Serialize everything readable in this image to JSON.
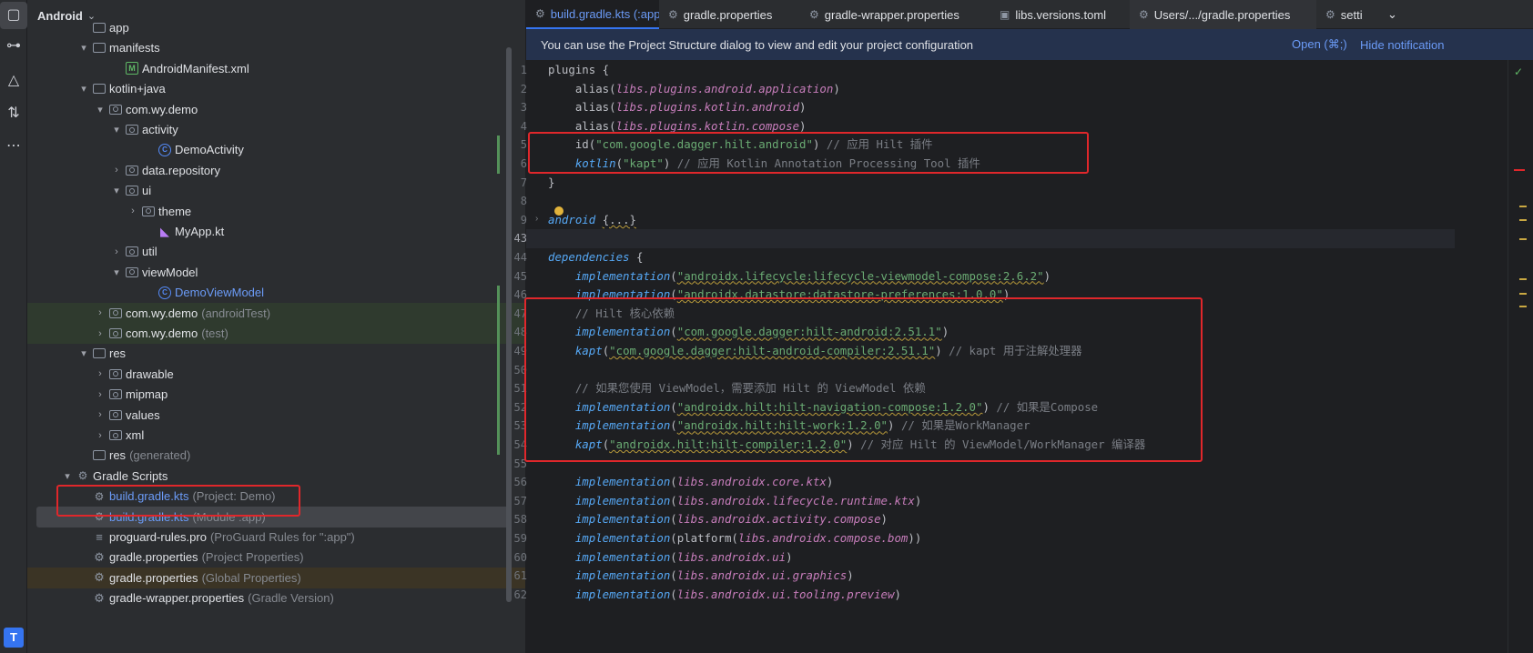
{
  "window": {
    "project_selector": "Android"
  },
  "activity_bar": {
    "icons": [
      "folder-icon",
      "commit-icon",
      "structure-icon",
      "pull-requests-icon",
      "more-icon",
      "terminal-icon"
    ]
  },
  "project_tree": {
    "rows": [
      {
        "indent": 3,
        "arrow": "",
        "icon": "folder",
        "label": "app",
        "hint": "",
        "style": ""
      },
      {
        "indent": 3,
        "arrow": "▾",
        "icon": "folder",
        "label": "manifests",
        "hint": "",
        "style": ""
      },
      {
        "indent": 5,
        "arrow": "",
        "icon": "manifest",
        "label": "AndroidManifest.xml",
        "hint": "",
        "style": ""
      },
      {
        "indent": 3,
        "arrow": "▾",
        "icon": "folder",
        "label": "kotlin+java",
        "hint": "",
        "style": ""
      },
      {
        "indent": 4,
        "arrow": "▾",
        "icon": "pkg",
        "label": "com.wy.demo",
        "hint": "",
        "style": ""
      },
      {
        "indent": 5,
        "arrow": "▾",
        "icon": "pkg",
        "label": "activity",
        "hint": "",
        "style": ""
      },
      {
        "indent": 7,
        "arrow": "",
        "icon": "class",
        "label": "DemoActivity",
        "hint": "",
        "style": ""
      },
      {
        "indent": 5,
        "arrow": "›",
        "icon": "pkg",
        "label": "data.repository",
        "hint": "",
        "style": ""
      },
      {
        "indent": 5,
        "arrow": "▾",
        "icon": "pkg",
        "label": "ui",
        "hint": "",
        "style": ""
      },
      {
        "indent": 6,
        "arrow": "›",
        "icon": "pkg",
        "label": "theme",
        "hint": "",
        "style": ""
      },
      {
        "indent": 7,
        "arrow": "",
        "icon": "kt",
        "label": "MyApp.kt",
        "hint": "",
        "style": ""
      },
      {
        "indent": 5,
        "arrow": "›",
        "icon": "pkg",
        "label": "util",
        "hint": "",
        "style": ""
      },
      {
        "indent": 5,
        "arrow": "▾",
        "icon": "pkg",
        "label": "viewModel",
        "hint": "",
        "style": ""
      },
      {
        "indent": 7,
        "arrow": "",
        "icon": "class",
        "label": "DemoViewModel",
        "hint": "",
        "style": "blue"
      },
      {
        "indent": 4,
        "arrow": "›",
        "icon": "pkg",
        "label": "com.wy.demo",
        "hint": "(androidTest)",
        "style": "green"
      },
      {
        "indent": 4,
        "arrow": "›",
        "icon": "pkg",
        "label": "com.wy.demo",
        "hint": "(test)",
        "style": "green"
      },
      {
        "indent": 3,
        "arrow": "▾",
        "icon": "folder",
        "label": "res",
        "hint": "",
        "style": ""
      },
      {
        "indent": 4,
        "arrow": "›",
        "icon": "pkg",
        "label": "drawable",
        "hint": "",
        "style": ""
      },
      {
        "indent": 4,
        "arrow": "›",
        "icon": "pkg",
        "label": "mipmap",
        "hint": "",
        "style": ""
      },
      {
        "indent": 4,
        "arrow": "›",
        "icon": "pkg",
        "label": "values",
        "hint": "",
        "style": ""
      },
      {
        "indent": 4,
        "arrow": "›",
        "icon": "pkg",
        "label": "xml",
        "hint": "",
        "style": ""
      },
      {
        "indent": 3,
        "arrow": "",
        "icon": "folder",
        "label": "res",
        "hint": "(generated)",
        "style": ""
      },
      {
        "indent": 2,
        "arrow": "▾",
        "icon": "gradle",
        "label": "Gradle Scripts",
        "hint": "",
        "style": ""
      },
      {
        "indent": 3,
        "arrow": "",
        "icon": "gradle",
        "label": "build.gradle.kts",
        "hint": "(Project: Demo)",
        "style": "blue"
      },
      {
        "indent": 3,
        "arrow": "",
        "icon": "gradle",
        "label": "build.gradle.kts",
        "hint": "(Module :app)",
        "style": "blue selected"
      },
      {
        "indent": 3,
        "arrow": "",
        "icon": "lines",
        "label": "proguard-rules.pro",
        "hint": "(ProGuard Rules for \":app\")",
        "style": ""
      },
      {
        "indent": 3,
        "arrow": "",
        "icon": "gear",
        "label": "gradle.properties",
        "hint": "(Project Properties)",
        "style": ""
      },
      {
        "indent": 3,
        "arrow": "",
        "icon": "gear",
        "label": "gradle.properties",
        "hint": "(Global Properties)",
        "style": "yellow"
      },
      {
        "indent": 3,
        "arrow": "",
        "icon": "gear",
        "label": "gradle-wrapper.properties",
        "hint": "(Gradle Version)",
        "style": ""
      }
    ]
  },
  "tabs": [
    {
      "label": "build.gradle.kts (:app)",
      "icon": "gradle",
      "active": true,
      "closable": true
    },
    {
      "label": "gradle.properties",
      "icon": "gear",
      "active": false,
      "closable": false
    },
    {
      "label": "gradle-wrapper.properties",
      "icon": "gear",
      "active": false,
      "closable": false
    },
    {
      "label": "libs.versions.toml",
      "icon": "toml",
      "active": false,
      "closable": false
    },
    {
      "label": "Users/.../gradle.properties",
      "icon": "gear",
      "active": false,
      "closable": false
    },
    {
      "label": "setti",
      "icon": "gradle",
      "active": false,
      "closable": false
    }
  ],
  "tabs_overflow": "⌄",
  "notification": {
    "text": "You can use the Project Structure dialog to view and edit your project configuration",
    "open_label": "Open (⌘;)",
    "hide_label": "Hide notification"
  },
  "editor": {
    "lines": [
      {
        "n": "1",
        "code": [
          [
            "plain",
            "plugins {"
          ]
        ]
      },
      {
        "n": "2",
        "code": [
          [
            "plain",
            "    alias("
          ],
          [
            "prop",
            "libs.plugins.android.application"
          ],
          [
            "plain",
            ")"
          ]
        ]
      },
      {
        "n": "3",
        "code": [
          [
            "plain",
            "    alias("
          ],
          [
            "prop",
            "libs.plugins.kotlin.android"
          ],
          [
            "plain",
            ")"
          ]
        ]
      },
      {
        "n": "4",
        "code": [
          [
            "plain",
            "    alias("
          ],
          [
            "prop",
            "libs.plugins.kotlin.compose"
          ],
          [
            "plain",
            ")"
          ]
        ]
      },
      {
        "n": "5",
        "code": [
          [
            "plain",
            "    id("
          ],
          [
            "str",
            "\"com.google.dagger.hilt.android\""
          ],
          [
            "plain",
            ") "
          ],
          [
            "cmt",
            "// 应用 Hilt 插件"
          ]
        ]
      },
      {
        "n": "6",
        "code": [
          [
            "plain",
            "    "
          ],
          [
            "fn",
            "kotlin"
          ],
          [
            "plain",
            "("
          ],
          [
            "str",
            "\"kapt\""
          ],
          [
            "plain",
            ") "
          ],
          [
            "cmt",
            "// 应用 Kotlin Annotation Processing Tool 插件"
          ]
        ]
      },
      {
        "n": "7",
        "code": [
          [
            "plain",
            "}"
          ]
        ]
      },
      {
        "n": "8",
        "code": [
          [
            "plain",
            ""
          ]
        ]
      },
      {
        "n": "9",
        "code": [
          [
            "fn",
            "android"
          ],
          [
            "plain",
            " "
          ],
          [
            "sq",
            "{...}"
          ]
        ]
      },
      {
        "n": "43",
        "code": [
          [
            "plain",
            ""
          ]
        ]
      },
      {
        "n": "44",
        "code": [
          [
            "fn",
            "dependencies"
          ],
          [
            "plain",
            " {"
          ]
        ]
      },
      {
        "n": "45",
        "code": [
          [
            "plain",
            "    "
          ],
          [
            "fn",
            "implementation"
          ],
          [
            "plain",
            "("
          ],
          [
            "strsq",
            "\"androidx.lifecycle:lifecycle-viewmodel-compose:2.6.2\""
          ],
          [
            "plain",
            ")"
          ]
        ]
      },
      {
        "n": "46",
        "code": [
          [
            "plain",
            "    "
          ],
          [
            "fn",
            "implementation"
          ],
          [
            "plain",
            "("
          ],
          [
            "strsq",
            "\"androidx.datastore:datastore-preferences:1.0.0\""
          ],
          [
            "plain",
            ")"
          ]
        ]
      },
      {
        "n": "47",
        "code": [
          [
            "cmt",
            "    // Hilt 核心依赖"
          ]
        ]
      },
      {
        "n": "48",
        "code": [
          [
            "plain",
            "    "
          ],
          [
            "fn",
            "implementation"
          ],
          [
            "plain",
            "("
          ],
          [
            "strsq",
            "\"com.google.dagger:hilt-android:2.51.1\""
          ],
          [
            "plain",
            ")"
          ]
        ]
      },
      {
        "n": "49",
        "code": [
          [
            "plain",
            "    "
          ],
          [
            "fn",
            "kapt"
          ],
          [
            "plain",
            "("
          ],
          [
            "strsq",
            "\"com.google.dagger:hilt-android-compiler:2.51.1\""
          ],
          [
            "plain",
            ") "
          ],
          [
            "cmt",
            "// kapt 用于注解处理器"
          ]
        ]
      },
      {
        "n": "50",
        "code": [
          [
            "plain",
            ""
          ]
        ]
      },
      {
        "n": "51",
        "code": [
          [
            "cmt",
            "    // 如果您使用 ViewModel，需要添加 Hilt 的 ViewModel 依赖"
          ]
        ]
      },
      {
        "n": "52",
        "code": [
          [
            "plain",
            "    "
          ],
          [
            "fn",
            "implementation"
          ],
          [
            "plain",
            "("
          ],
          [
            "strsq",
            "\"androidx.hilt:hilt-navigation-compose:1.2.0\""
          ],
          [
            "plain",
            ") "
          ],
          [
            "cmt",
            "// 如果是Compose"
          ]
        ]
      },
      {
        "n": "53",
        "code": [
          [
            "plain",
            "    "
          ],
          [
            "fn",
            "implementation"
          ],
          [
            "plain",
            "("
          ],
          [
            "strsq",
            "\"androidx.hilt:hilt-work:1.2.0\""
          ],
          [
            "plain",
            ") "
          ],
          [
            "cmt",
            "// 如果是WorkManager"
          ]
        ]
      },
      {
        "n": "54",
        "code": [
          [
            "plain",
            "    "
          ],
          [
            "fn",
            "kapt"
          ],
          [
            "plain",
            "("
          ],
          [
            "strsq",
            "\"androidx.hilt:hilt-compiler:1.2.0\""
          ],
          [
            "plain",
            ") "
          ],
          [
            "cmt",
            "// 对应 Hilt 的 ViewModel/WorkManager 编译器"
          ]
        ]
      },
      {
        "n": "55",
        "code": [
          [
            "plain",
            ""
          ]
        ]
      },
      {
        "n": "56",
        "code": [
          [
            "plain",
            "    "
          ],
          [
            "fn",
            "implementation"
          ],
          [
            "plain",
            "("
          ],
          [
            "prop",
            "libs.androidx.core.ktx"
          ],
          [
            "plain",
            ")"
          ]
        ]
      },
      {
        "n": "57",
        "code": [
          [
            "plain",
            "    "
          ],
          [
            "fn",
            "implementation"
          ],
          [
            "plain",
            "("
          ],
          [
            "prop",
            "libs.androidx.lifecycle.runtime.ktx"
          ],
          [
            "plain",
            ")"
          ]
        ]
      },
      {
        "n": "58",
        "code": [
          [
            "plain",
            "    "
          ],
          [
            "fn",
            "implementation"
          ],
          [
            "plain",
            "("
          ],
          [
            "prop",
            "libs.androidx.activity.compose"
          ],
          [
            "plain",
            ")"
          ]
        ]
      },
      {
        "n": "59",
        "code": [
          [
            "plain",
            "    "
          ],
          [
            "fn",
            "implementation"
          ],
          [
            "plain",
            "(platform("
          ],
          [
            "prop",
            "libs.androidx.compose.bom"
          ],
          [
            "plain",
            "))"
          ]
        ]
      },
      {
        "n": "60",
        "code": [
          [
            "plain",
            "    "
          ],
          [
            "fn",
            "implementation"
          ],
          [
            "plain",
            "("
          ],
          [
            "prop",
            "libs.androidx.ui"
          ],
          [
            "plain",
            ")"
          ]
        ]
      },
      {
        "n": "61",
        "code": [
          [
            "plain",
            "    "
          ],
          [
            "fn",
            "implementation"
          ],
          [
            "plain",
            "("
          ],
          [
            "prop",
            "libs.androidx.ui.graphics"
          ],
          [
            "plain",
            ")"
          ]
        ]
      },
      {
        "n": "62",
        "code": [
          [
            "plain",
            "    "
          ],
          [
            "fn",
            "implementation"
          ],
          [
            "plain",
            "("
          ],
          [
            "prop",
            "libs.androidx.ui.tooling.preview"
          ],
          [
            "plain",
            ")"
          ]
        ]
      }
    ]
  },
  "colors": {
    "accent": "#3574f0",
    "highlight_box": "#e0272b",
    "added_marker": "#549159"
  }
}
